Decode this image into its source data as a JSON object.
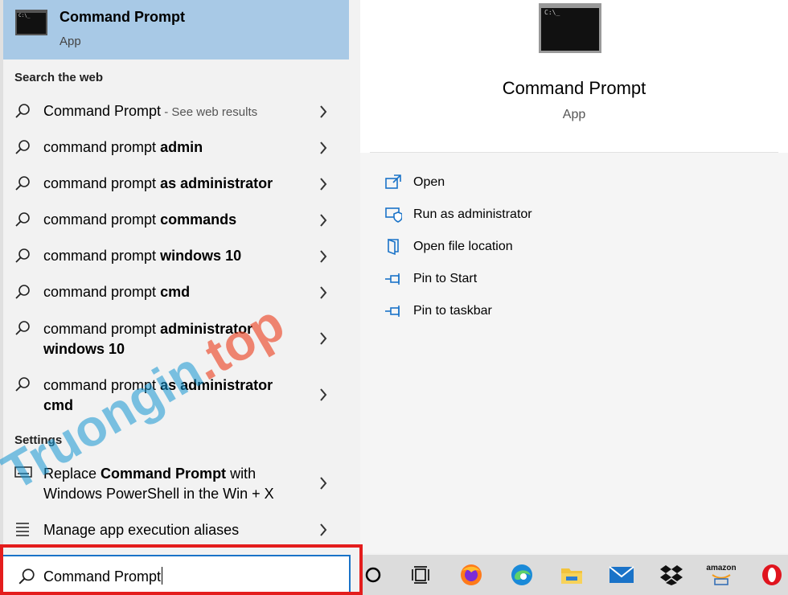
{
  "best_match": {
    "title": "Command Prompt",
    "subtitle": "App",
    "icon": "cmd-app-icon",
    "icon_text": "C:\\_"
  },
  "web_section": {
    "heading": "Search the web",
    "items": [
      {
        "prefix": "Command Prompt",
        "bold": "",
        "suffix": " - See web results"
      },
      {
        "prefix": "command prompt ",
        "bold": "admin",
        "suffix": ""
      },
      {
        "prefix": "command prompt ",
        "bold": "as administrator",
        "suffix": ""
      },
      {
        "prefix": "command prompt ",
        "bold": "commands",
        "suffix": ""
      },
      {
        "prefix": "command prompt ",
        "bold": "windows 10",
        "suffix": ""
      },
      {
        "prefix": "command prompt ",
        "bold": "cmd",
        "suffix": ""
      },
      {
        "prefix": "command prompt ",
        "bold": "administrator windows 10",
        "suffix": ""
      },
      {
        "prefix": "command prompt ",
        "bold": "as administrator cmd",
        "suffix": ""
      }
    ]
  },
  "settings_section": {
    "heading": "Settings",
    "items": [
      {
        "pre": "Replace ",
        "bold": "Command Prompt",
        "post": " with Windows PowerShell in the Win + X",
        "icon": "keyboard-icon"
      },
      {
        "pre": "",
        "bold": "",
        "post": "Manage app execution aliases",
        "icon": "list-icon"
      }
    ]
  },
  "preview": {
    "title": "Command Prompt",
    "subtitle": "App",
    "actions": [
      {
        "label": "Open",
        "icon": "open-icon"
      },
      {
        "label": "Run as administrator",
        "icon": "shield-icon"
      },
      {
        "label": "Open file location",
        "icon": "folder-location-icon"
      },
      {
        "label": "Pin to Start",
        "icon": "pin-icon"
      },
      {
        "label": "Pin to taskbar",
        "icon": "pin-icon"
      }
    ]
  },
  "search": {
    "query": "Command Prompt"
  },
  "taskbar": {
    "apps": [
      "cortana-icon",
      "task-view-icon",
      "firefox-icon",
      "edge-icon",
      "file-explorer-icon",
      "mail-icon",
      "dropbox-icon",
      "amazon-icon",
      "opera-icon"
    ],
    "amazon_text": "amazon"
  },
  "watermark": {
    "text_a": "Truongin",
    "text_b": ".top"
  },
  "colors": {
    "accent": "#1a73c8",
    "selected": "#a8c9e6",
    "highlight_frame": "#e41d1d"
  }
}
